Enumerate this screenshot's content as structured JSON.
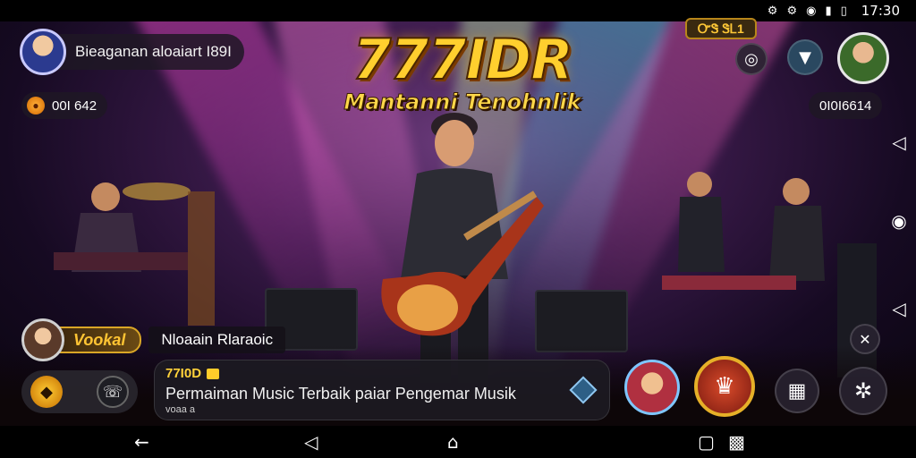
{
  "status_bar": {
    "icons": [
      "settings-icon",
      "sync-icon",
      "wifi-icon",
      "signal-icon",
      "battery-icon"
    ],
    "time": "17:30"
  },
  "profile": {
    "username": "Bieaganan aloaiart I89I",
    "coins": "00I 642",
    "gems": "0I0I6614"
  },
  "logo": {
    "title": "777IDR",
    "subtitle": "Mantanni Tenohnlik"
  },
  "event_tag": "ᏅᏕ ᏕᏞ1",
  "vocal": {
    "tag": "Vookal",
    "name": "Nloaain Rlaraoic"
  },
  "info": {
    "badge": "77I0D",
    "text": "Permaiman Music Terbaik paiar Pengemar Musik",
    "small": "voaa a"
  },
  "side_icons": [
    "volume-icon",
    "record-icon",
    "volume-alt-icon"
  ],
  "nav": {
    "back_icon": "back-arrow-icon",
    "triangle_icon": "back-triangle-icon",
    "home_icon": "home-icon",
    "recents_icon": "recents-icon",
    "keyboard_icon": "keyboard-switch-icon"
  },
  "colors": {
    "accent_gold": "#ffcf2e",
    "panel_dark": "#1c1a22",
    "beam_pink": "#ff4fd8",
    "beam_cyan": "#62e6ff"
  }
}
